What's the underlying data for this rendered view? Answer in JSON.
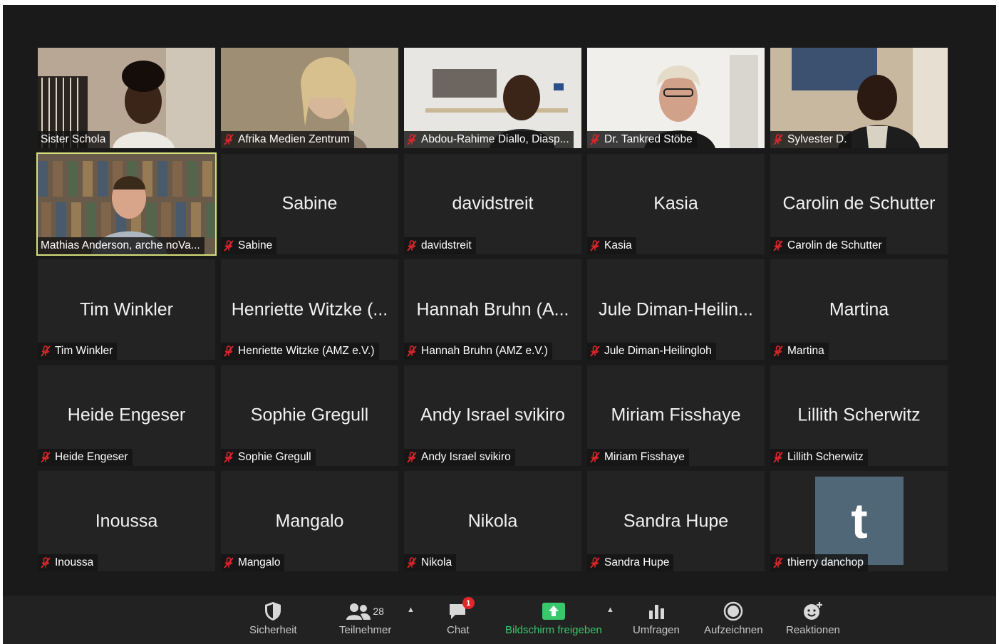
{
  "participants": [
    {
      "name": "Sister Schola",
      "display": "",
      "label": "Sister Schola",
      "muted": false,
      "video": "v1"
    },
    {
      "name": "Afrika Medien Zentrum",
      "display": "",
      "label": "Afrika Medien Zentrum",
      "muted": true,
      "video": "v2"
    },
    {
      "name": "Abdou-Rahime Diallo",
      "display": "",
      "label": "Abdou-Rahime Diallo, Diasp...",
      "muted": true,
      "video": "v3"
    },
    {
      "name": "Dr. Tankred Stöbe",
      "display": "",
      "label": "Dr. Tankred Stöbe",
      "muted": true,
      "video": "v4"
    },
    {
      "name": "Sylvester D.",
      "display": "",
      "label": "Sylvester D.",
      "muted": true,
      "video": "v5"
    },
    {
      "name": "Mathias Anderson",
      "display": "",
      "label": "Mathias Anderson, arche noVa...",
      "muted": false,
      "video": "v6",
      "active": true
    },
    {
      "name": "Sabine",
      "display": "Sabine",
      "label": "Sabine",
      "muted": true
    },
    {
      "name": "davidstreit",
      "display": "davidstreit",
      "label": "davidstreit",
      "muted": true
    },
    {
      "name": "Kasia",
      "display": "Kasia",
      "label": "Kasia",
      "muted": true
    },
    {
      "name": "Carolin de Schutter",
      "display": "Carolin de Schutter",
      "label": "Carolin de Schutter",
      "muted": true
    },
    {
      "name": "Tim Winkler",
      "display": "Tim Winkler",
      "label": "Tim Winkler",
      "muted": true
    },
    {
      "name": "Henriette Witzke",
      "display": "Henriette Witzke (...",
      "label": "Henriette Witzke (AMZ e.V.)",
      "muted": true
    },
    {
      "name": "Hannah Bruhn",
      "display": "Hannah Bruhn (A...",
      "label": "Hannah Bruhn (AMZ e.V.)",
      "muted": true
    },
    {
      "name": "Jule Diman-Heilingloh",
      "display": "Jule Diman-Heilin...",
      "label": "Jule Diman-Heilingloh",
      "muted": true
    },
    {
      "name": "Martina",
      "display": "Martina",
      "label": "Martina",
      "muted": true
    },
    {
      "name": "Heide Engeser",
      "display": "Heide Engeser",
      "label": "Heide Engeser",
      "muted": true
    },
    {
      "name": "Sophie Gregull",
      "display": "Sophie Gregull",
      "label": "Sophie Gregull",
      "muted": true
    },
    {
      "name": "Andy Israel svikiro",
      "display": "Andy Israel svikiro",
      "label": "Andy Israel svikiro",
      "muted": true
    },
    {
      "name": "Miriam Fisshaye",
      "display": "Miriam Fisshaye",
      "label": "Miriam Fisshaye",
      "muted": true
    },
    {
      "name": "Lillith Scherwitz",
      "display": "Lillith Scherwitz",
      "label": "Lillith Scherwitz",
      "muted": true
    },
    {
      "name": "Inoussa",
      "display": "Inoussa",
      "label": "Inoussa",
      "muted": true
    },
    {
      "name": "Mangalo",
      "display": "Mangalo",
      "label": "Mangalo",
      "muted": true
    },
    {
      "name": "Nikola",
      "display": "Nikola",
      "label": "Nikola",
      "muted": true
    },
    {
      "name": "Sandra Hupe",
      "display": "Sandra Hupe",
      "label": "Sandra Hupe",
      "muted": true
    },
    {
      "name": "thierry danchop",
      "display": "",
      "label": "thierry danchop",
      "muted": true,
      "avatar": "t"
    }
  ],
  "toolbar": {
    "security": {
      "label": "Sicherheit",
      "icon": "shield-icon"
    },
    "participants": {
      "label": "Teilnehmer",
      "count": "28",
      "icon": "participants-icon"
    },
    "chat": {
      "label": "Chat",
      "badge": "1",
      "icon": "chat-icon"
    },
    "share": {
      "label": "Bildschirm freigeben",
      "icon": "share-screen-icon"
    },
    "polls": {
      "label": "Umfragen",
      "icon": "polls-icon"
    },
    "record": {
      "label": "Aufzeichnen",
      "icon": "record-icon"
    },
    "reactions": {
      "label": "Reaktionen",
      "icon": "reactions-icon"
    }
  },
  "colors": {
    "background": "#1a1a1a",
    "tile": "#232323",
    "active_border": "#d6e07a",
    "muted_icon": "#e0262b",
    "share_green": "#38c86b",
    "avatar_bg": "#4f6776"
  }
}
